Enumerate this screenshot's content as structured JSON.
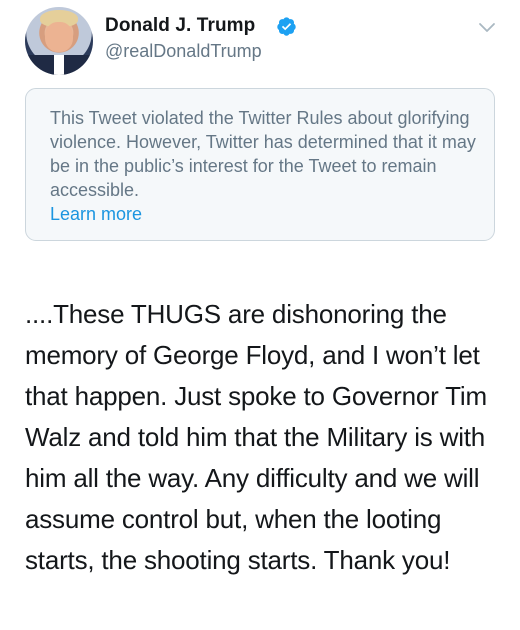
{
  "author": {
    "display_name": "Donald J. Trump",
    "handle": "@realDonaldTrump",
    "verified": true,
    "avatar": "profile-photo"
  },
  "icons": {
    "verified": "verified-badge-icon",
    "menu": "chevron-down-icon"
  },
  "notice": {
    "message": "This Tweet violated the Twitter Rules about glorifying violence. However, Twitter has determined that it may be in the public’s interest for the Tweet to remain accessible.",
    "link_label": "Learn more"
  },
  "tweet": {
    "text": "....These THUGS are dishonoring the memory of George Floyd, and I won’t let that happen. Just spoke to Governor Tim Walz and told him that the Military is with him all the way. Any difficulty and we will assume control but, when the looting starts, the shooting starts. Thank you!"
  },
  "colors": {
    "link": "#1b95e0",
    "verified": "#1da1f2",
    "secondary_text": "#657786",
    "notice_background": "#f5f8fa",
    "notice_border": "#ccd6dd"
  }
}
